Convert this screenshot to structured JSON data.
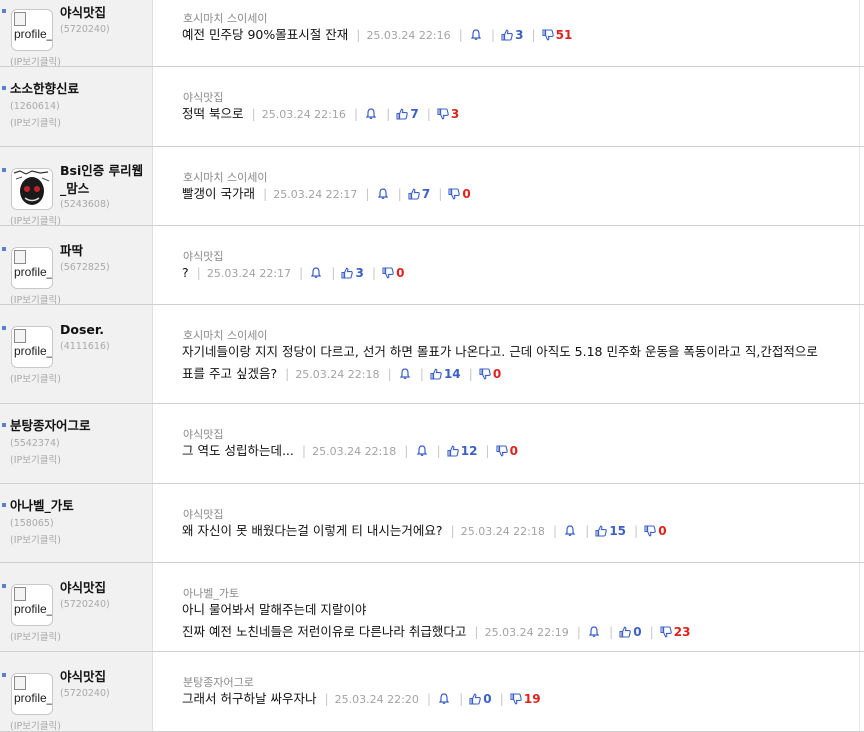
{
  "meta_labels": {
    "ip_link": "(IP보기클릭)",
    "avatar_alt": "profile_"
  },
  "colors": {
    "upvote": "#3b5fc7",
    "downvote": "#e0221f",
    "bullet": "#5a83c7"
  },
  "comments": [
    {
      "nick": "야식맛집",
      "uid": "(5720240)",
      "ip": "(IP보기클릭)",
      "avatar": "broken",
      "target": "호시마치 스이세이",
      "lines": [
        "예전 민주당 90%몰표시절 잔재"
      ],
      "date": "25.03.24 22:16",
      "up": "3",
      "down": "51"
    },
    {
      "nick": "소소한향신료",
      "uid": "(1260614)",
      "ip": "(IP보기클릭)",
      "avatar": "none",
      "target": "야식맛집",
      "lines": [
        "정떡 북으로"
      ],
      "date": "25.03.24 22:16",
      "up": "7",
      "down": "3"
    },
    {
      "nick": "Bsi인증 루리웹_맘스",
      "nick_lines": [
        "Bsi인증 루리웹",
        "_맘스"
      ],
      "uid": "(5243608)",
      "ip": "(IP보기클릭)",
      "avatar": "image",
      "target": "호시마치 스이세이",
      "lines": [
        "빨갱이 국가래"
      ],
      "date": "25.03.24 22:17",
      "up": "7",
      "down": "0"
    },
    {
      "nick": "파딱",
      "uid": "(5672825)",
      "ip": "(IP보기클릭)",
      "avatar": "broken",
      "target": "야식맛집",
      "lines": [
        "?"
      ],
      "date": "25.03.24 22:17",
      "up": "3",
      "down": "0"
    },
    {
      "nick": "Doser.",
      "uid": "(4111616)",
      "ip": "(IP보기클릭)",
      "avatar": "broken",
      "target": "호시마치 스이세이",
      "lines": [
        "자기네들이랑 지지 정당이 다르고, 선거 하면 몰표가 나온다고. 근데 아직도 5.18 민주화 운동을 폭동이라고 직,간접적으로",
        "표를 주고 싶겠음?"
      ],
      "date": "25.03.24 22:18",
      "up": "14",
      "down": "0"
    },
    {
      "nick": "분탕종자어그로",
      "uid": "(5542374)",
      "ip": "(IP보기클릭)",
      "avatar": "none",
      "target": "야식맛집",
      "lines": [
        "그 역도 성립하는데..."
      ],
      "date": "25.03.24 22:18",
      "up": "12",
      "down": "0"
    },
    {
      "nick": "아나벨_가토",
      "uid": "(158065)",
      "ip": "(IP보기클릭)",
      "avatar": "none",
      "target": "야식맛집",
      "lines": [
        "왜 자신이 못 배웠다는걸 이렇게 티 내시는거에요?"
      ],
      "date": "25.03.24 22:18",
      "up": "15",
      "down": "0"
    },
    {
      "nick": "야식맛집",
      "uid": "(5720240)",
      "ip": "(IP보기클릭)",
      "avatar": "broken",
      "target": "아나벨_가토",
      "lines": [
        "아니 물어봐서 말해주는데 지랄이야",
        "진짜 예전 노친네들은 저런이유로 다른나라 취급했다고"
      ],
      "date": "25.03.24 22:19",
      "up": "0",
      "down": "23"
    },
    {
      "nick": "야식맛집",
      "uid": "(5720240)",
      "ip": "(IP보기클릭)",
      "avatar": "broken",
      "target": "분탕종자어그로",
      "lines": [
        "그래서 허구하날 싸우자나"
      ],
      "date": "25.03.24 22:20",
      "up": "0",
      "down": "19"
    }
  ]
}
